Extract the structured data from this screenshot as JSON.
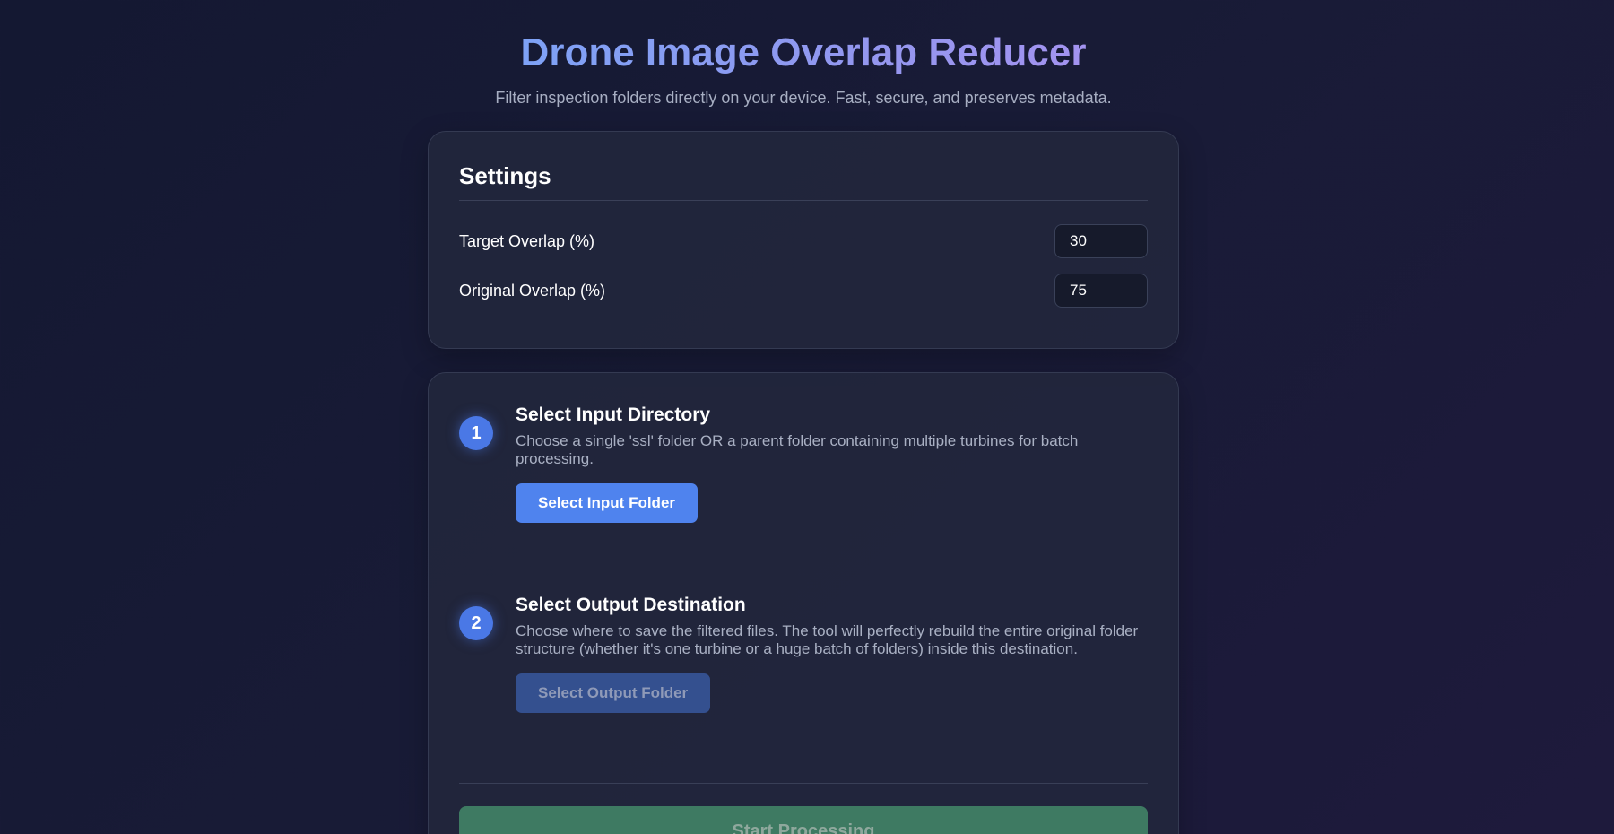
{
  "header": {
    "title": "Drone Image Overlap Reducer",
    "subtitle": "Filter inspection folders directly on your device. Fast, secure, and preserves metadata."
  },
  "settings": {
    "title": "Settings",
    "target_overlap": {
      "label": "Target Overlap (%)",
      "value": "30"
    },
    "original_overlap": {
      "label": "Original Overlap (%)",
      "value": "75"
    }
  },
  "steps": [
    {
      "number": "1",
      "title": "Select Input Directory",
      "description": "Choose a single 'ssl' folder OR a parent folder containing multiple turbines for batch processing.",
      "button_label": "Select Input Folder",
      "button_enabled": true
    },
    {
      "number": "2",
      "title": "Select Output Destination",
      "description": "Choose where to save the filtered files. The tool will perfectly rebuild the entire original folder structure (whether it's one turbine or a huge batch of folders) inside this destination.",
      "button_label": "Select Output Folder",
      "button_enabled": false
    }
  ],
  "actions": {
    "start_label": "Start Processing",
    "start_enabled": false
  },
  "colors": {
    "background": "#161a34",
    "card": "#22273c",
    "accent": "#4f83ee",
    "step_badge": "#4a78e6",
    "disabled_button": "#34508f",
    "start_button": "#3e7a62",
    "title_gradient_start": "#7ea2f6",
    "title_gradient_end": "#a393f0"
  }
}
